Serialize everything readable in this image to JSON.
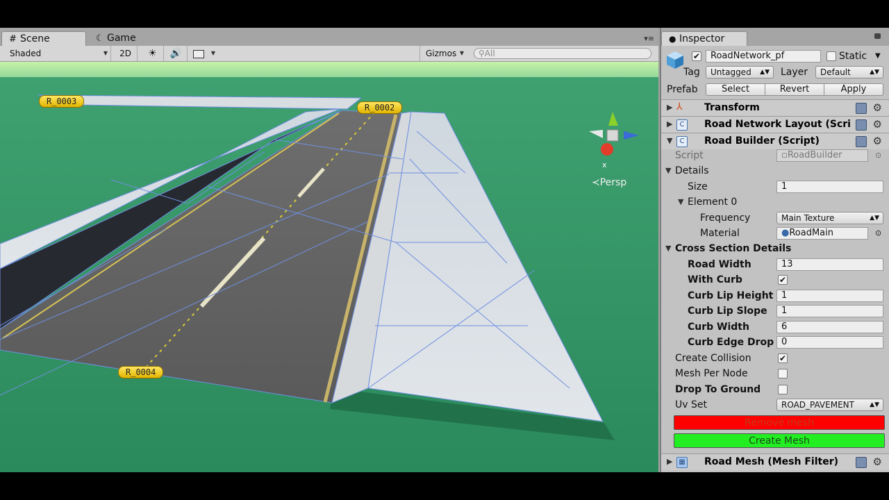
{
  "scene": {
    "tab_scene": "Scene",
    "tab_game": "Game",
    "shading_mode": "Shaded",
    "mode_2d": "2D",
    "gizmos_label": "Gizmos",
    "search_placeholder": "All",
    "persp_label": "Persp",
    "node_labels": [
      "R_0003",
      "R_0002",
      "R_0004"
    ],
    "gizmo_axes": [
      "y",
      "x"
    ]
  },
  "inspector": {
    "tab_label": "Inspector",
    "object_name": "RoadNetwork_pf",
    "static_label": "Static",
    "tag_label": "Tag",
    "tag_value": "Untagged",
    "layer_label": "Layer",
    "layer_value": "Default",
    "prefab_label": "Prefab",
    "prefab_buttons": [
      "Select",
      "Revert",
      "Apply"
    ],
    "components": {
      "transform": "Transform",
      "road_network_layout": "Road Network Layout (Scri",
      "road_builder": "Road Builder (Script)",
      "road_mesh": "Road Mesh (Mesh Filter)"
    },
    "script_label": "Script",
    "script_value": "RoadBuilder",
    "details_label": "Details",
    "size_label": "Size",
    "size_value": "1",
    "element0_label": "Element 0",
    "frequency_label": "Frequency",
    "frequency_value": "Main Texture",
    "material_label": "Material",
    "material_value": "RoadMain",
    "cross_section_label": "Cross Section Details",
    "road_width_label": "Road Width",
    "road_width_value": "13",
    "with_curb_label": "With Curb",
    "with_curb_checked": true,
    "curb_lip_height_label": "Curb Lip Height",
    "curb_lip_height_value": "1",
    "curb_lip_slope_label": "Curb Lip Slope",
    "curb_lip_slope_value": "1",
    "curb_width_label": "Curb Width",
    "curb_width_value": "6",
    "curb_edge_drop_label": "Curb Edge Drop",
    "curb_edge_drop_value": "0",
    "create_collision_label": "Create Collision",
    "create_collision_checked": true,
    "mesh_per_node_label": "Mesh Per Node",
    "mesh_per_node_checked": false,
    "drop_to_ground_label": "Drop To Ground",
    "drop_to_ground_checked": false,
    "uv_set_label": "Uv Set",
    "uv_set_value": "ROAD_PAVEMENT",
    "remove_mesh_label": "Remove mesh",
    "create_mesh_label": "Create Mesh"
  },
  "colors": {
    "remove_button": "#ff0000",
    "create_button": "#22ee22",
    "scene_sky": "#c8f2a8",
    "scene_ground": "#2f8f62"
  }
}
